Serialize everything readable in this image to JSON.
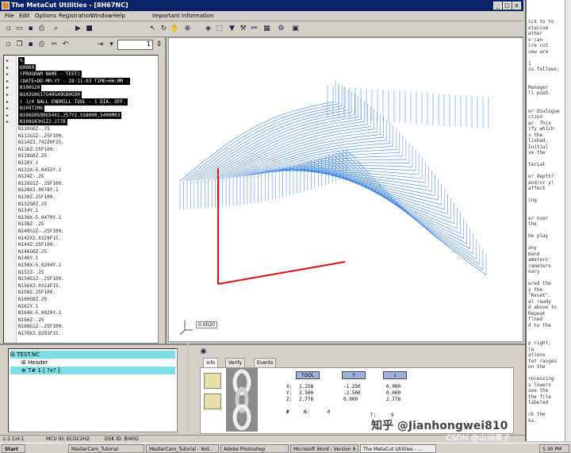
{
  "window": {
    "title": "The MetaCut Utilities - [8H67NC]",
    "controls": [
      "_",
      "□",
      "x"
    ]
  },
  "menu": [
    "File",
    "Edit",
    "Options",
    "Registration",
    "Window",
    "Help",
    "Important Information"
  ],
  "left_toolbar": {
    "value": "1"
  },
  "nc_lines": [
    {
      "text": "%",
      "sel": true
    },
    {
      "text": "O0000",
      "sel": true
    },
    {
      "text": "(PROGRAM NAME - TEST)",
      "sel": true
    },
    {
      "text": "(DATE=DD-MM-YY - 28-11-03 TIME=HH:MM -",
      "sel": true
    },
    {
      "text": "N100G20",
      "sel": true
    },
    {
      "text": "N102G0G17G40G49G80G90",
      "sel": true
    },
    {
      "text": "( 1/4 BALL ENDMILL TOOL - 1 DIA. OFF.",
      "sel": true
    },
    {
      "text": "N104T1M6",
      "sel": true
    },
    {
      "text": "N106G0G90G54X1.257Y2.5S8000.5400M03",
      "sel": true
    },
    {
      "text": "N108G43H1Z2.2778",
      "sel": true
    },
    {
      "text": "N110G0Z-.75",
      "sel": false
    },
    {
      "text": "N112G1Z-.25F100.",
      "sel": false
    },
    {
      "text": "N114Z3.742Z0F15.",
      "sel": false
    },
    {
      "text": "N116Z.25F100.",
      "sel": false
    },
    {
      "text": "N118G0Z.25",
      "sel": false
    },
    {
      "text": "N120Y.1",
      "sel": false
    },
    {
      "text": "N122X-5.0452Y.1",
      "sel": false
    },
    {
      "text": "N124Z-.25",
      "sel": false
    },
    {
      "text": "N126G1Z-.25F100.",
      "sel": false
    },
    {
      "text": "N128X3.0078Y.1",
      "sel": false
    },
    {
      "text": "N130Z.25F100.",
      "sel": false
    },
    {
      "text": "N132G0Z.25",
      "sel": false
    },
    {
      "text": "N134Y.1",
      "sel": false
    },
    {
      "text": "N136X-5.0479Y.1",
      "sel": false
    },
    {
      "text": "N138Z-.25",
      "sel": false
    },
    {
      "text": "N140G1Z-.25F100.",
      "sel": false
    },
    {
      "text": "N142X3.0329F15.",
      "sel": false
    },
    {
      "text": "N144Z.25F100.",
      "sel": false
    },
    {
      "text": "N146G0Z.25",
      "sel": false
    },
    {
      "text": "N148Y.1",
      "sel": false
    },
    {
      "text": "N150X-5.0294Y.1",
      "sel": false
    },
    {
      "text": "N152Z-.25",
      "sel": false
    },
    {
      "text": "N154G1Z-.25F100.",
      "sel": false
    },
    {
      "text": "N156X3.0322F15.",
      "sel": false
    },
    {
      "text": "N158Z.25F100.",
      "sel": false
    },
    {
      "text": "N160G0Z.25",
      "sel": false
    },
    {
      "text": "N162Y.1",
      "sel": false
    },
    {
      "text": "N164X-5.0020Y.1",
      "sel": false
    },
    {
      "text": "N166Z-.25",
      "sel": false
    },
    {
      "text": "N168G1Z-.25F100.",
      "sel": false
    },
    {
      "text": "N170X3.0291F15.",
      "sel": false
    }
  ],
  "viewport": {
    "scale_label": "0.0020"
  },
  "tree": [
    {
      "label": "TEST.NC",
      "hl": true
    },
    {
      "label": "Header",
      "hl": false
    },
    {
      "label": "T# 1      [ ?x? ]",
      "hl": true
    }
  ],
  "bottom": {
    "tabs": [
      "Info",
      "Verify",
      "Events"
    ],
    "headers": [
      "TOOL",
      "↑",
      "↓"
    ],
    "axes": [
      "X:",
      "Y:",
      "Z:"
    ],
    "col1": [
      "1.258",
      "2.500",
      "2.778"
    ],
    "col2": [
      "-1.250",
      "-2.500",
      "0.000"
    ],
    "col3": [
      "0.000",
      "0.000",
      "2.778"
    ],
    "n_label": "N:",
    "n_value": "0",
    "t_label": "T:",
    "t_value": "9"
  },
  "status": {
    "left": "L:1 Col:1",
    "mid1": "MCU ID: ECGC2H2",
    "mid2": "DSK ID: BI40G"
  },
  "rightdoc_lines": [
    "ick to to",
    "eteccum",
    "ather",
    "o can",
    "ire cut",
    "vew are",
    "",
    "1",
    "is follows:",
    "",
    "",
    "Manager",
    "ll push.",
    "",
    "",
    "er dialogue",
    "ction",
    "ar. This",
    "ify which",
    "s the",
    "lished.",
    "Initial",
    "ve the",
    "",
    "terial",
    "",
    "er depth?",
    "and/or y)",
    "affect",
    "",
    "ing",
    "",
    "",
    "er over",
    "the",
    "",
    "he play",
    "",
    "any",
    "mand",
    "ameters'",
    "rameters",
    "nary",
    "",
    "ered the",
    "y the",
    "\"Reset\".",
    "al ready",
    "d above to",
    "Repeat",
    "flned",
    "d to the",
    "",
    "",
    "p right,",
    "ra",
    "ations",
    "tet ranges",
    "on the",
    "",
    "rocessing",
    "s lowers",
    "see the",
    "the file",
    "labeled",
    "",
    "ck the",
    "ks."
  ],
  "taskbar": [
    "Start",
    "MasterCam_Tutorial",
    "MasterCam_Tutorial - Not...",
    "Adobe Photoshop",
    "Microsoft Word - Version 9",
    "The MetaCut Utilities - ...",
    "5:30 PM"
  ],
  "watermark": {
    "line1": "知乎 @Jianhongwei810",
    "line2": "CSDN @山涧果子"
  },
  "colors": {
    "titlebar": "#0a246a",
    "toolpath": "#3a82e6",
    "axis": "#dd1111",
    "highlight": "#7fdde6"
  }
}
